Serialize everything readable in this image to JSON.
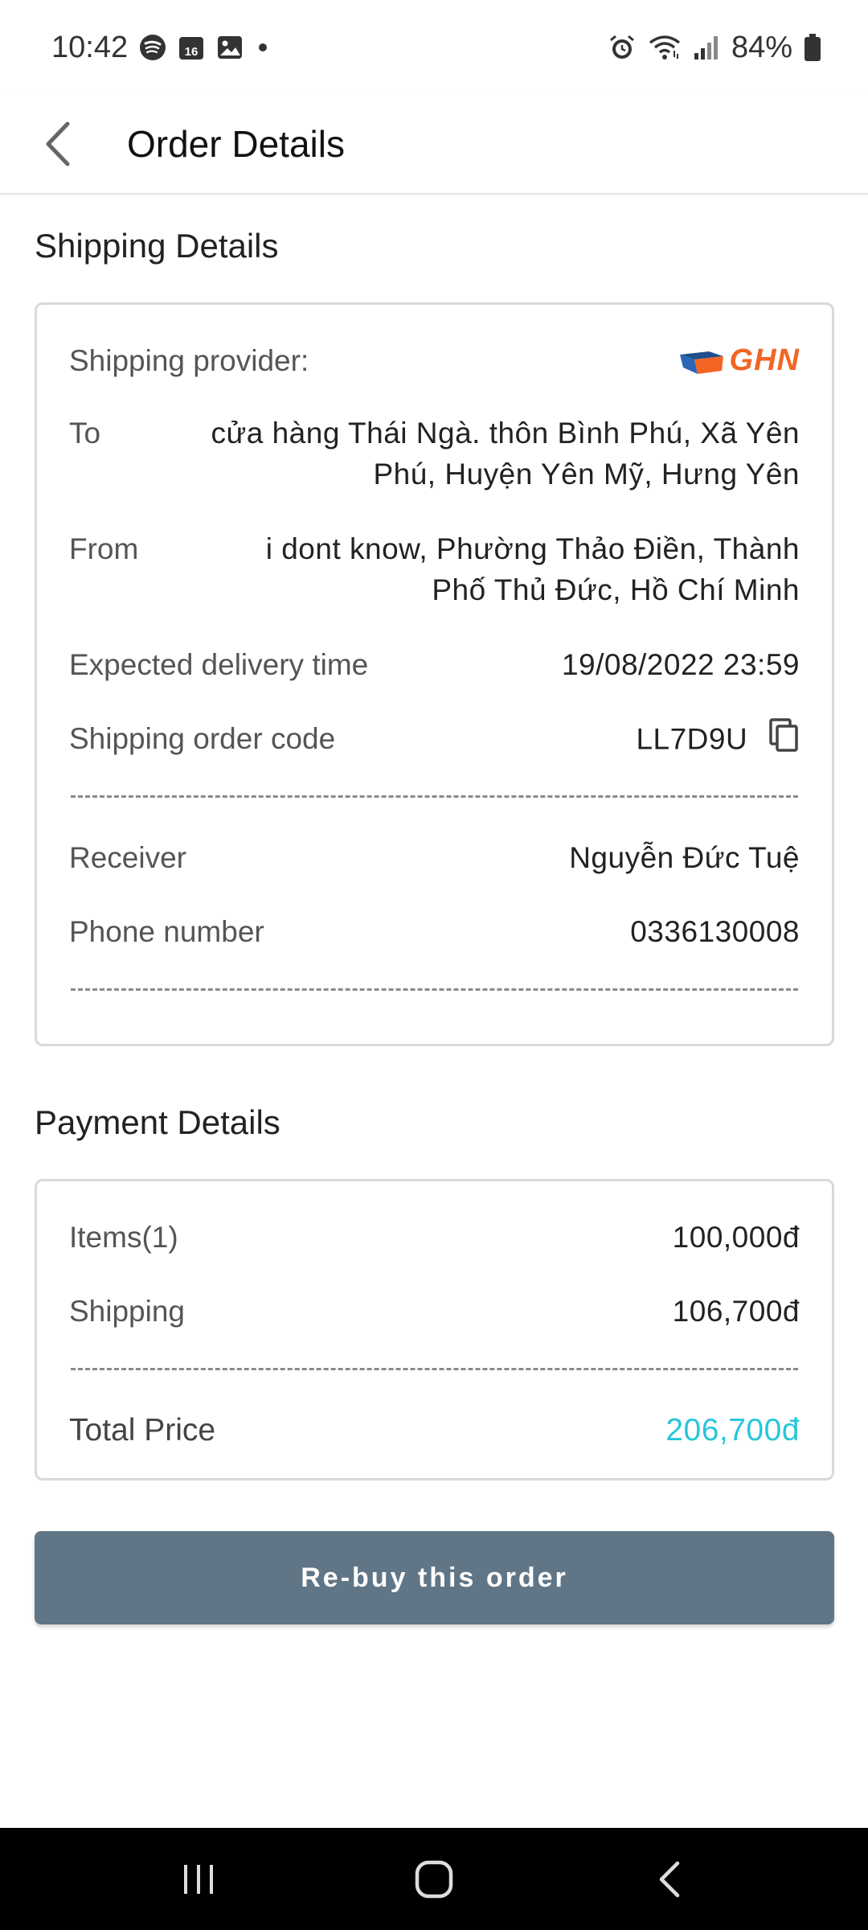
{
  "status_bar": {
    "time": "10:42",
    "calendar_day": "16",
    "battery": "84%",
    "left_icons": [
      "spotify-icon",
      "calendar-icon",
      "gallery-icon",
      "dot-icon"
    ],
    "right_icons": [
      "alarm-icon",
      "wifi-icon",
      "signal-icon",
      "battery-icon"
    ]
  },
  "header": {
    "title": "Order Details",
    "back_icon": "chevron-left-icon"
  },
  "shipping": {
    "section_title": "Shipping Details",
    "provider_label": "Shipping provider:",
    "provider_logo_text": "GHN",
    "to_label": "To",
    "to_line1": "cửa hàng Thái Ngà. thôn Bình Phú, Xã Yên",
    "to_line2": "Phú, Huyện Yên Mỹ, Hưng Yên",
    "from_label": "From",
    "from_line1": "i dont know, Phường Thảo Điền, Thành",
    "from_line2": "Phố Thủ Đức, Hồ Chí Minh",
    "expected_label": "Expected delivery time",
    "expected_value": "19/08/2022 23:59",
    "order_code_label": "Shipping order code",
    "order_code_value": "LL7D9U",
    "copy_icon": "copy-icon",
    "receiver_label": "Receiver",
    "receiver_value": "Nguyễn Đức Tuệ",
    "phone_label": "Phone number",
    "phone_value": "0336130008"
  },
  "payment": {
    "section_title": "Payment Details",
    "items_label": "Items(1)",
    "items_value": "100,000đ",
    "shipping_label": "Shipping",
    "shipping_value": "106,700đ",
    "total_label": "Total Price",
    "total_value": "206,700đ",
    "total_color": "#26c6da"
  },
  "actions": {
    "rebuy_label": "Re-buy this order",
    "button_color": "#607687"
  },
  "nav": {
    "icons": [
      "recent-apps-icon",
      "home-icon",
      "back-icon"
    ]
  }
}
